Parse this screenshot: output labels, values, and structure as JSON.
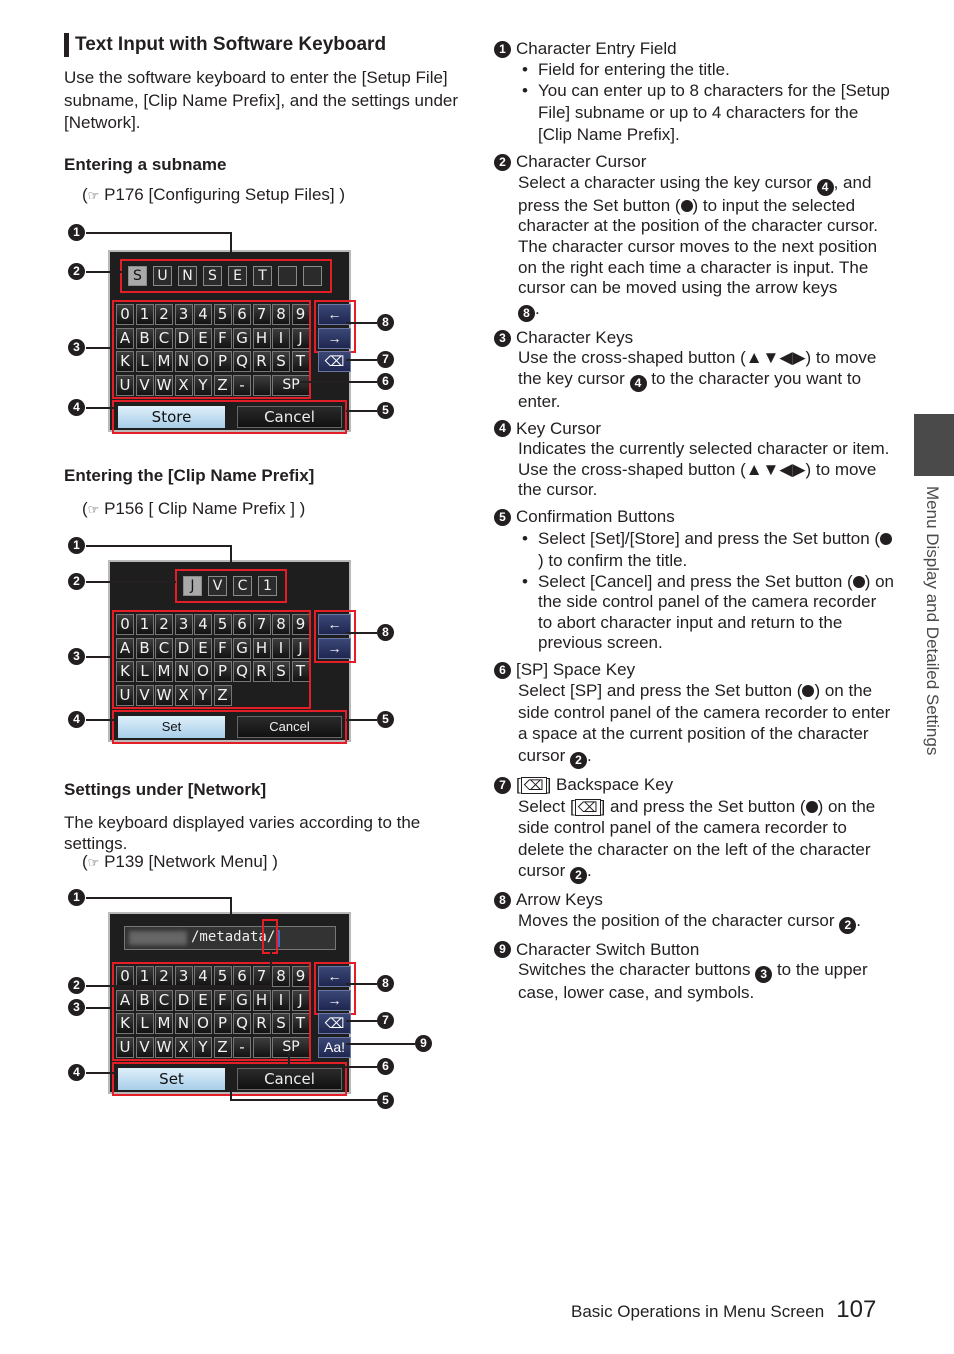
{
  "section": {
    "title": "Text Input with Software Keyboard",
    "intro": "Use the software keyboard to enter the [Setup File] subname, [Clip Name Prefix], and the settings under [Network]."
  },
  "subsections": [
    {
      "heading": "Entering a subname",
      "ref_icon": "pointing-hand-icon",
      "ref": "P176 [Configuring Setup Files] )",
      "keyboard": {
        "entry_chars": [
          "S",
          "U",
          "N",
          "S",
          "E",
          "T",
          "",
          ""
        ],
        "rows": [
          [
            "0",
            "1",
            "2",
            "3",
            "4",
            "5",
            "6",
            "7",
            "8",
            "9"
          ],
          [
            "A",
            "B",
            "C",
            "D",
            "E",
            "F",
            "G",
            "H",
            "I",
            "J"
          ],
          [
            "K",
            "L",
            "M",
            "N",
            "O",
            "P",
            "Q",
            "R",
            "S",
            "T"
          ],
          [
            "U",
            "V",
            "W",
            "X",
            "Y",
            "Z",
            "-",
            ""
          ]
        ],
        "space_key": "SP",
        "arrow_left": "←",
        "arrow_right": "→",
        "backspace": "⌫",
        "ok_button": "Store",
        "cancel_button": "Cancel",
        "callouts": [
          "1",
          "2",
          "3",
          "4",
          "5",
          "6",
          "7",
          "8"
        ]
      }
    },
    {
      "heading": "Entering the [Clip Name Prefix]",
      "ref_icon": "pointing-hand-icon",
      "ref": "P156 [ Clip Name Prefix ] )",
      "keyboard": {
        "entry_chars": [
          "J",
          "V",
          "C",
          "1"
        ],
        "rows": [
          [
            "0",
            "1",
            "2",
            "3",
            "4",
            "5",
            "6",
            "7",
            "8",
            "9"
          ],
          [
            "A",
            "B",
            "C",
            "D",
            "E",
            "F",
            "G",
            "H",
            "I",
            "J"
          ],
          [
            "K",
            "L",
            "M",
            "N",
            "O",
            "P",
            "Q",
            "R",
            "S",
            "T"
          ],
          [
            "U",
            "V",
            "W",
            "X",
            "Y",
            "Z"
          ]
        ],
        "arrow_left": "←",
        "arrow_right": "→",
        "ok_button": "Set",
        "cancel_button": "Cancel",
        "callouts": [
          "1",
          "2",
          "3",
          "4",
          "5",
          "8"
        ]
      }
    },
    {
      "heading": "Settings under [Network]",
      "text": "The keyboard displayed varies according to the settings.",
      "ref_icon": "pointing-hand-icon",
      "ref": "P139 [Network Menu] )",
      "keyboard": {
        "entry_text": "/metadata/",
        "rows": [
          [
            "0",
            "1",
            "2",
            "3",
            "4",
            "5",
            "6",
            "7",
            "8",
            "9"
          ],
          [
            "A",
            "B",
            "C",
            "D",
            "E",
            "F",
            "G",
            "H",
            "I",
            "J"
          ],
          [
            "K",
            "L",
            "M",
            "N",
            "O",
            "P",
            "Q",
            "R",
            "S",
            "T"
          ],
          [
            "U",
            "V",
            "W",
            "X",
            "Y",
            "Z",
            "-",
            ""
          ]
        ],
        "space_key": "SP",
        "arrow_left": "←",
        "arrow_right": "→",
        "backspace": "⌫",
        "switch_key": "Aa!",
        "ok_button": "Set",
        "cancel_button": "Cancel",
        "callouts": [
          "1",
          "2",
          "3",
          "4",
          "5",
          "6",
          "7",
          "8",
          "9"
        ]
      }
    }
  ],
  "descriptions": [
    {
      "num": "1",
      "title": "Character Entry Field",
      "bullets": [
        "Field for entering the title.",
        "You can enter up to 8 characters for the [Setup File] subname or up to 4 characters for the [Clip Name Prefix]."
      ]
    },
    {
      "num": "2",
      "title": "Character Cursor",
      "lines": [
        "Select a character using the key cursor",
        ", and press the Set button (",
        ") to input the selected character at the position of the character cursor. The character cursor moves to the next position on the right each time a character is input. The cursor can be moved using the arrow keys",
        "."
      ]
    },
    {
      "num": "3",
      "title": "Character Keys",
      "lines": [
        "Use the cross-shaped button (▲▼◀▶) to move the key cursor",
        "to the character you want to enter."
      ]
    },
    {
      "num": "4",
      "title": "Key Cursor",
      "text": "Indicates the currently selected character or item. Use the cross-shaped button (▲▼◀▶) to move the cursor."
    },
    {
      "num": "5",
      "title": "Confirmation Buttons",
      "bullets": [
        "Select [Set]/[Store] and press the Set button (",
        ") to confirm the title.",
        "Select [Cancel] and press the Set button (",
        ") on the side control panel of the camera recorder to abort character input and return to the previous screen."
      ]
    },
    {
      "num": "6",
      "title": "[SP] Space Key",
      "lines": [
        "Select [SP] and press the Set button (",
        ") on the side control panel of the camera recorder to enter a space at the current position of the character cursor",
        "."
      ]
    },
    {
      "num": "7",
      "title_pre": "[",
      "title_post": "] Backspace Key",
      "lines": [
        "Select [",
        "] and press the Set button (",
        ") on the side control panel of the camera recorder to delete the character on the left of the character cursor",
        "."
      ]
    },
    {
      "num": "8",
      "title": "Arrow Keys",
      "lines": [
        "Moves the position of the character cursor",
        "."
      ]
    },
    {
      "num": "9",
      "title": "Character Switch Button",
      "lines": [
        "Switches the character buttons",
        "to the upper case, lower case, and symbols."
      ]
    }
  ],
  "side_tab": {
    "label": "Menu Display and Detailed Settings"
  },
  "footer": {
    "section": "Basic Operations in Menu Screen",
    "page": "107"
  },
  "glyphs": {
    "hand": "☞",
    "backspace_glyph": "⌫"
  }
}
